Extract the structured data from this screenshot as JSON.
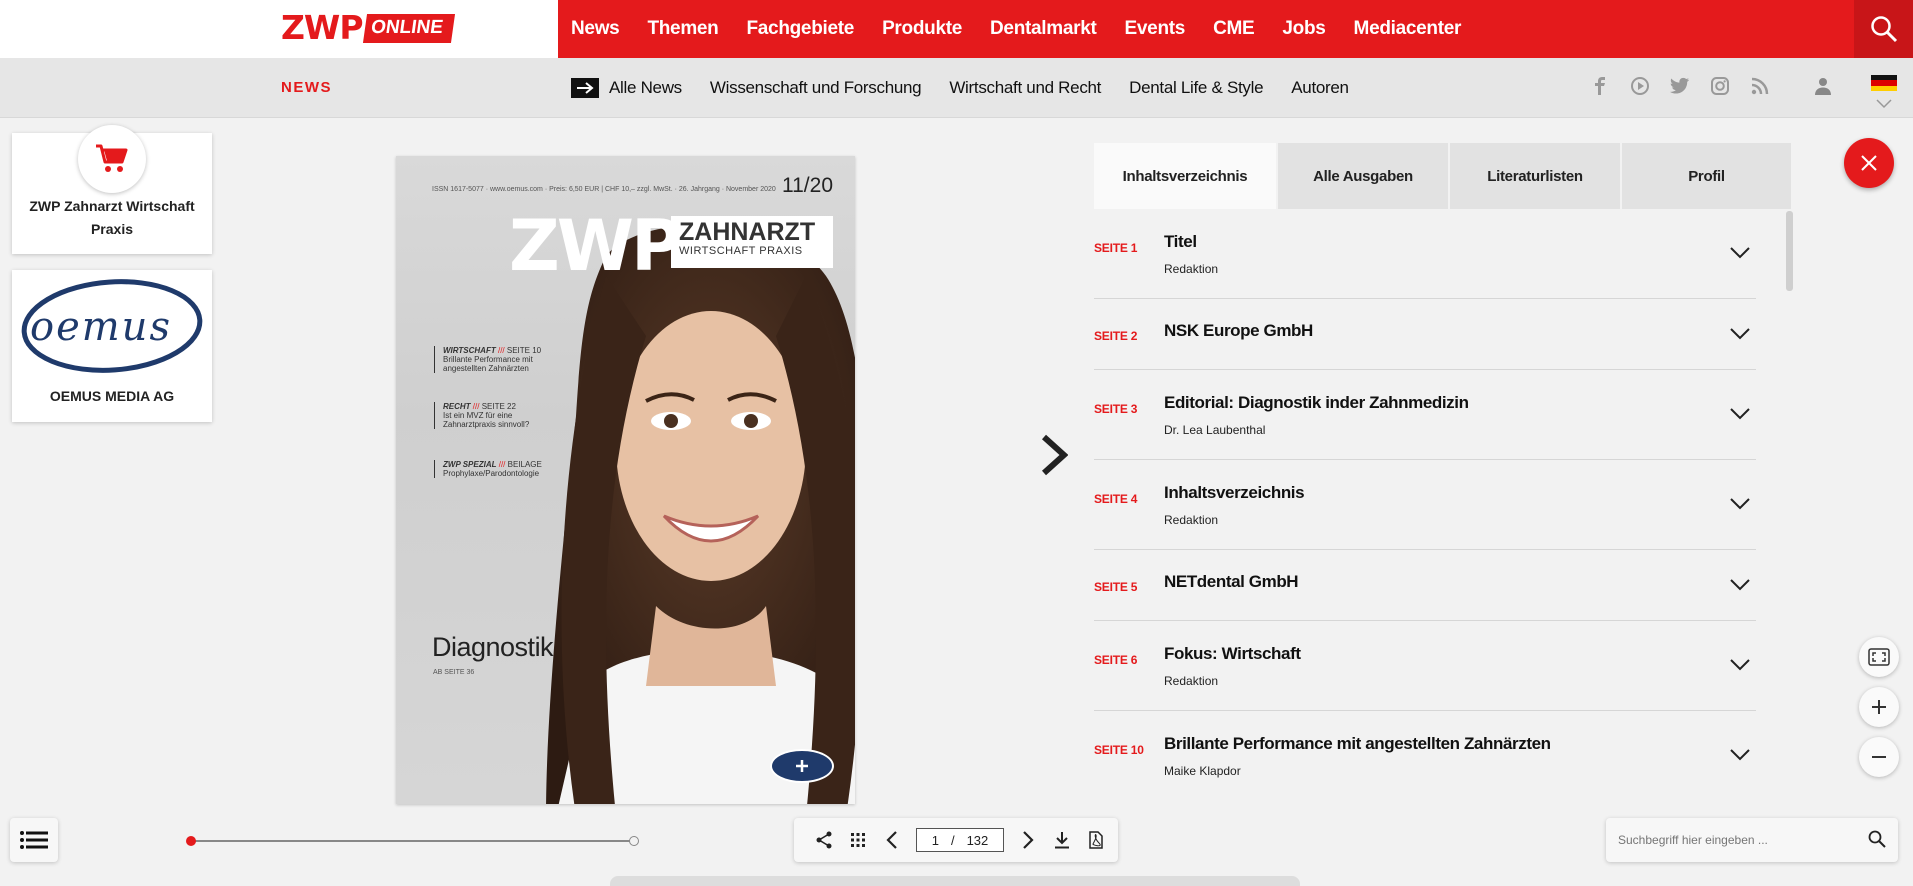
{
  "header": {
    "logo_main": "ZWP",
    "logo_badge": "ONLINE",
    "nav": [
      "News",
      "Themen",
      "Fachgebiete",
      "Produkte",
      "Dentalmarkt",
      "Events",
      "CME",
      "Jobs",
      "Mediacenter"
    ]
  },
  "subheader": {
    "section": "NEWS",
    "all_news": "Alle News",
    "links": [
      "Wissenschaft und Forschung",
      "Wirtschaft und Recht",
      "Dental Life & Style",
      "Autoren"
    ]
  },
  "sidebar": {
    "cards": [
      {
        "label": "ZWP Zahnarzt Wirtschaft Praxis"
      },
      {
        "label": "OEMUS MEDIA AG"
      }
    ]
  },
  "cover": {
    "meta": "ISSN 1617-5077 · www.oemus.com · Preis: 6,50 EUR | CHF 10,– zzgl. MwSt. · 26. Jahrgang · November 2020",
    "issue": "11/20",
    "brand": "ZWP",
    "brand_line1": "ZAHNARZT",
    "brand_line2": "WIRTSCHAFT PRAXIS",
    "teasers": [
      {
        "head": "WIRTSCHAFT",
        "sep": "///",
        "page": "SEITE 10",
        "text": "Brillante Performance mit angestellten Zahnärzten"
      },
      {
        "head": "RECHT",
        "sep": "///",
        "page": "SEITE 22",
        "text": "Ist ein MVZ für eine Zahnarztpraxis sinnvoll?"
      },
      {
        "head": "ZWP SPEZIAL",
        "sep": "///",
        "page": "BEILAGE",
        "text": "Prophylaxe/Parodontologie"
      }
    ],
    "topic": "Diagnostik",
    "topic_sub": "AB SEITE 36"
  },
  "tabs": [
    "Inhaltsverzeichnis",
    "Alle Ausgaben",
    "Literaturlisten",
    "Profil"
  ],
  "toc": [
    {
      "page": "SEITE 1",
      "title": "Titel",
      "author": "Redaktion"
    },
    {
      "page": "SEITE 2",
      "title": "NSK Europe GmbH",
      "author": ""
    },
    {
      "page": "SEITE 3",
      "title": "Editorial: Diagnostik inder Zahnmedizin",
      "author": "Dr. Lea Laubenthal"
    },
    {
      "page": "SEITE 4",
      "title": "Inhaltsverzeichnis",
      "author": "Redaktion"
    },
    {
      "page": "SEITE 5",
      "title": "NETdental GmbH",
      "author": ""
    },
    {
      "page": "SEITE 6",
      "title": "Fokus: Wirtschaft",
      "author": "Redaktion"
    },
    {
      "page": "SEITE 10",
      "title": "Brillante Performance mit angestellten Zahnärzten",
      "author": "Maike Klapdor"
    }
  ],
  "pager": {
    "current": "1",
    "separator": "/",
    "total": "132"
  },
  "search": {
    "placeholder": "Suchbegriff hier eingeben ..."
  },
  "colors": {
    "brand_red": "#e41a1c"
  }
}
